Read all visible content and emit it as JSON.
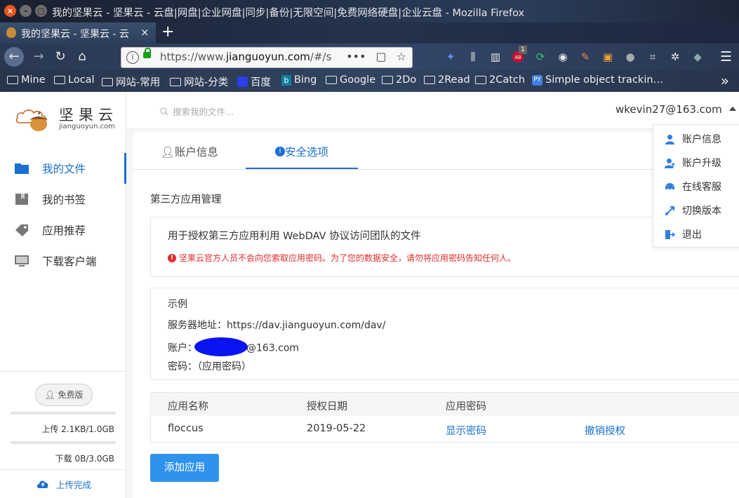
{
  "window": {
    "title": "我的坚果云 - 坚果云 - 云盘|网盘|企业网盘|同步|备份|无限空间|免费网络硬盘|企业云盘 - Mozilla Firefox"
  },
  "tab": {
    "label": "我的坚果云 - 坚果云 - 云"
  },
  "address": {
    "scheme": "https://www.",
    "host": "jianguoyun.com",
    "path": "/#/saf"
  },
  "toolbar": {
    "adblock_count": "1"
  },
  "bookmarks": [
    {
      "label": "Mine",
      "icon": "folder-icon"
    },
    {
      "label": "Local",
      "icon": "folder-icon"
    },
    {
      "label": "网站-常用",
      "icon": "folder-icon"
    },
    {
      "label": "网站-分类",
      "icon": "folder-icon"
    },
    {
      "label": "百度",
      "icon": "baidu-icon"
    },
    {
      "label": "Bing",
      "icon": "bing-icon"
    },
    {
      "label": "Google",
      "icon": "folder-icon"
    },
    {
      "label": "2Do",
      "icon": "folder-icon"
    },
    {
      "label": "2Read",
      "icon": "folder-icon"
    },
    {
      "label": "2Catch",
      "icon": "folder-icon"
    },
    {
      "label": "Simple object trackin…",
      "icon": "site-icon"
    }
  ],
  "brand": {
    "name_cn": "坚果云",
    "name_en": "jianguoyun.com"
  },
  "sidebar": {
    "items": [
      {
        "label": "我的文件",
        "icon": "folder-icon",
        "active": true
      },
      {
        "label": "我的书签",
        "icon": "bookmark-icon",
        "active": false
      },
      {
        "label": "应用推荐",
        "icon": "tag-icon",
        "active": false
      },
      {
        "label": "下载客户端",
        "icon": "monitor-icon",
        "active": false
      }
    ],
    "plan_badge": "免费版",
    "upload_quota": "上传 2.1KB/1.0GB",
    "download_quota": "下载 0B/3.0GB",
    "upload_status": "上传完成"
  },
  "header": {
    "search_placeholder": "搜索我的文件...",
    "user_email": "wkevin27@163.com"
  },
  "tabs": [
    {
      "label": "账户信息",
      "active": false
    },
    {
      "label": "安全选项",
      "active": true
    }
  ],
  "third_party": {
    "title": "第三方应用管理",
    "description": "用于授权第三方应用利用 WebDAV 协议访问团队的文件",
    "warning": "坚果云官方人员不会向您索取应用密码。为了您的数据安全，请勿将应用密码告知任何人。",
    "example": {
      "heading": "示例",
      "server_label": "服务器地址：",
      "server_value": "https://dav.jianguoyun.com/dav/",
      "account_label": "账户：",
      "account_suffix": "@163.com",
      "password_label": "密码：",
      "password_value": "（应用密码）"
    },
    "table": {
      "headers": [
        "应用名称",
        "授权日期",
        "应用密码"
      ],
      "rows": [
        {
          "name": "floccus",
          "date": "2019-05-22",
          "show_password": "显示密码",
          "revoke": "撤销授权"
        }
      ]
    },
    "add_button": "添加应用"
  },
  "dropdown": {
    "items": [
      {
        "label": "账户信息",
        "icon": "user-icon"
      },
      {
        "label": "账户升级",
        "icon": "user-upgrade-icon"
      },
      {
        "label": "在线客服",
        "icon": "headset-icon"
      },
      {
        "label": "切换版本",
        "icon": "switch-icon"
      },
      {
        "label": "退出",
        "icon": "logout-icon"
      }
    ]
  },
  "colors": {
    "accent": "#1a6fd1",
    "button": "#2f93ee",
    "warning": "#e12b2b"
  }
}
